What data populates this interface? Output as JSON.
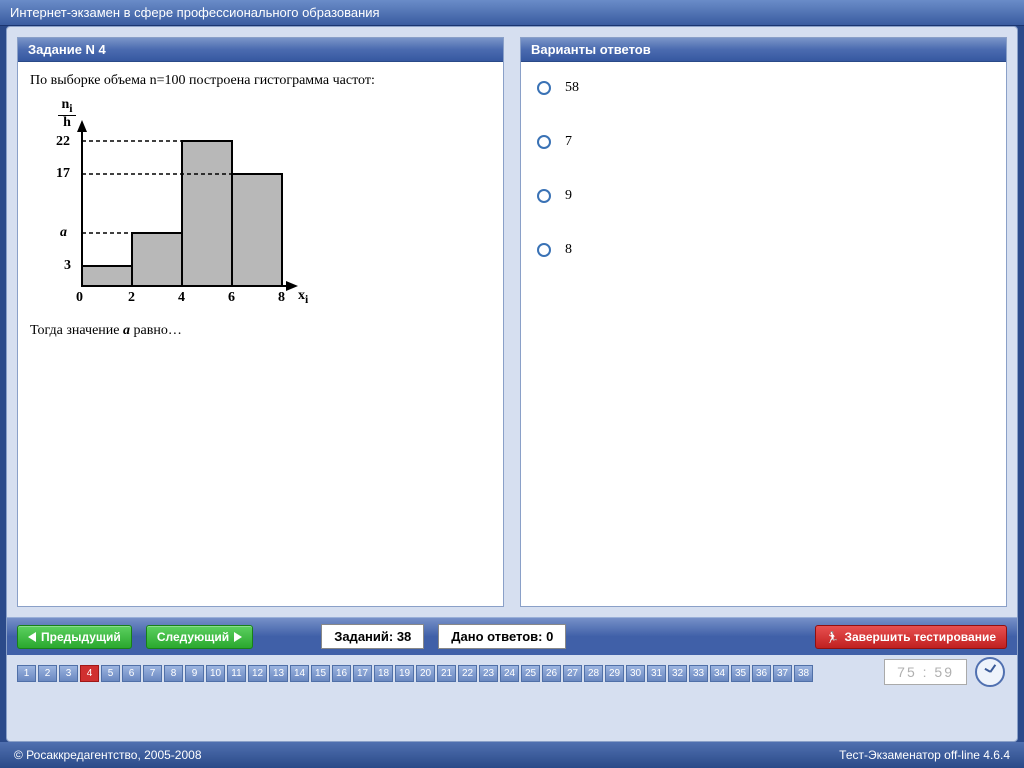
{
  "window": {
    "title": "Интернет-экзамен в сфере профессионального образования"
  },
  "question_panel": {
    "header": "Задание N 4",
    "text_before": "По выборке объема n=100 построена гистограмма частот:",
    "text_after": "Тогда значение a равно…"
  },
  "answers_panel": {
    "header": "Варианты ответов",
    "options": [
      "58",
      "7",
      "9",
      "8"
    ]
  },
  "nav": {
    "prev": "Предыдущий",
    "next": "Следующий",
    "total_label": "Заданий: 38",
    "answered_label": "Дано ответов: 0",
    "finish": "Завершить тестирование"
  },
  "qnav": {
    "count": 38,
    "current": 4
  },
  "timer": "75 : 59",
  "footer": {
    "left": "© Росаккредагентство, 2005-2008",
    "right": "Тест-Экзаменатор off-line 4.6.4"
  },
  "chart_data": {
    "type": "bar",
    "ylabel": "nᵢ / h",
    "xlabel": "xᵢ",
    "x_edges": [
      0,
      2,
      4,
      6,
      8
    ],
    "heights": [
      3,
      "a",
      22,
      17
    ],
    "y_ticks": [
      3,
      "a",
      17,
      22
    ],
    "x_ticks": [
      0,
      2,
      4,
      6,
      8
    ],
    "unknown_symbol": "a",
    "note": "histogram of frequencies for sample n=100; bar edges at 0,2,4,6,8; heights 3, a (unknown ≈8), 22, 17"
  }
}
